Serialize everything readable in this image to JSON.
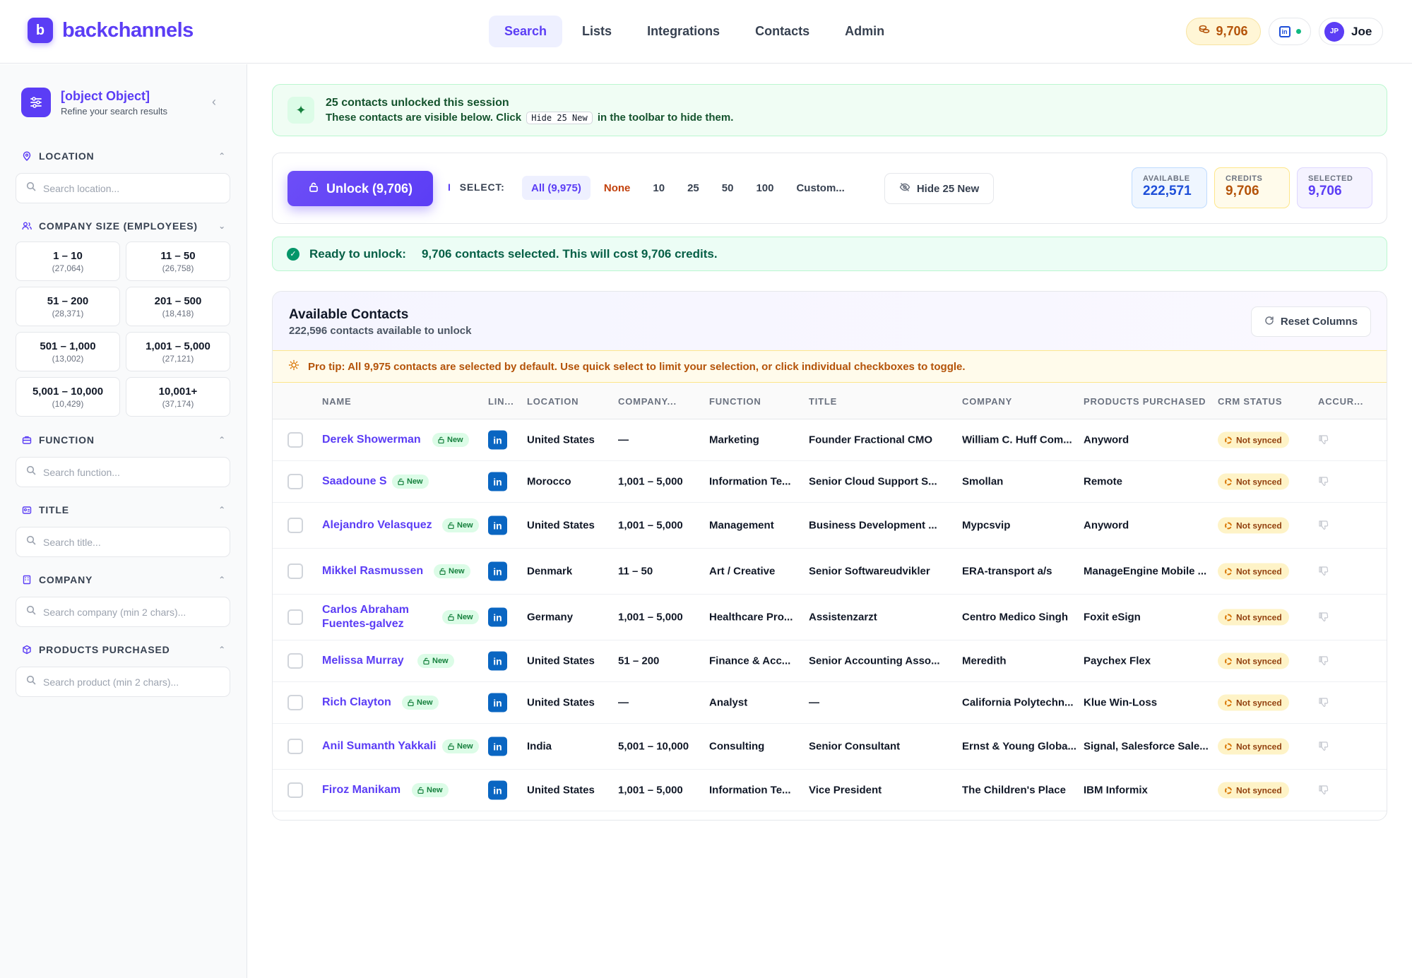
{
  "app": {
    "logo_letter": "b",
    "brand": "backchannels"
  },
  "nav": {
    "items": [
      {
        "label": "Search",
        "active": true
      },
      {
        "label": "Lists",
        "active": false
      },
      {
        "label": "Integrations",
        "active": false
      },
      {
        "label": "Contacts",
        "active": false
      },
      {
        "label": "Admin",
        "active": false
      }
    ]
  },
  "header": {
    "credits": "9,706",
    "user_initials": "JP",
    "user_name": "Joe"
  },
  "sidebar": {
    "title": {
      "heading": "TITLE",
      "placeholder": "Search title..."
    },
    "subtitle": "Refine your search results",
    "location": {
      "heading": "LOCATION",
      "placeholder": "Search location..."
    },
    "company_size": {
      "heading": "COMPANY SIZE (EMPLOYEES)",
      "options": [
        {
          "label": "1 – 10",
          "count": "(27,064)"
        },
        {
          "label": "11 – 50",
          "count": "(26,758)"
        },
        {
          "label": "51 – 200",
          "count": "(28,371)"
        },
        {
          "label": "201 – 500",
          "count": "(18,418)"
        },
        {
          "label": "501 – 1,000",
          "count": "(13,002)"
        },
        {
          "label": "1,001 – 5,000",
          "count": "(27,121)"
        },
        {
          "label": "5,001 – 10,000",
          "count": "(10,429)"
        },
        {
          "label": "10,001+",
          "count": "(37,174)"
        }
      ]
    },
    "function": {
      "heading": "FUNCTION",
      "placeholder": "Search function..."
    },
    "company": {
      "heading": "COMPANY",
      "placeholder": "Search company (min 2 chars)..."
    },
    "products": {
      "heading": "PRODUCTS PURCHASED",
      "placeholder": "Search product (min 2 chars)..."
    }
  },
  "session_banner": {
    "title": "25 contacts unlocked this session",
    "sub_before": "These contacts are visible below. Click",
    "code": "Hide 25 New",
    "sub_after": "in the toolbar to hide them."
  },
  "toolbar": {
    "unlock_label": "Unlock (9,706)",
    "select_label": "SELECT:",
    "select_options": [
      "All (9,975)",
      "None",
      "10",
      "25",
      "50",
      "100",
      "Custom..."
    ],
    "hide_label": "Hide 25 New",
    "stats": {
      "available_label": "AVAILABLE",
      "available_value": "222,571",
      "credits_label": "CREDITS",
      "credits_value": "9,706",
      "selected_label": "SELECTED",
      "selected_value": "9,706"
    }
  },
  "ready": {
    "label": "Ready to unlock:",
    "message": "9,706 contacts selected. This will cost 9,706 credits."
  },
  "table": {
    "title": "Available Contacts",
    "subtitle": "222,596 contacts available to unlock",
    "reset_label": "Reset Columns",
    "tip": "Pro tip: All 9,975 contacts are selected by default. Use quick select to limit your selection, or click individual checkboxes to toggle.",
    "columns": [
      "NAME",
      "LIN...",
      "LOCATION",
      "COMPANY...",
      "FUNCTION",
      "TITLE",
      "COMPANY",
      "PRODUCTS PURCHASED",
      "CRM STATUS",
      "ACCUR..."
    ],
    "new_label": "New",
    "linkedin_label": "in",
    "crm_label": "Not synced",
    "rows": [
      {
        "name": "Derek Showerman",
        "location": "United States",
        "size": "—",
        "function": "Marketing",
        "title": "Founder Fractional CMO",
        "company": "William C. Huff Com...",
        "products": "Anyword"
      },
      {
        "name": "Saadoune S",
        "location": "Morocco",
        "size": "1,001 – 5,000",
        "function": "Information Te...",
        "title": "Senior Cloud Support S...",
        "company": "Smollan",
        "products": "Remote"
      },
      {
        "name": "Alejandro Velasquez",
        "location": "United States",
        "size": "1,001 – 5,000",
        "function": "Management",
        "title": "Business Development ...",
        "company": "Mypcsvip",
        "products": "Anyword"
      },
      {
        "name": "Mikkel Rasmussen",
        "location": "Denmark",
        "size": "11 – 50",
        "function": "Art / Creative",
        "title": "Senior Softwareudvikler",
        "company": "ERA-transport a/s",
        "products": "ManageEngine Mobile ..."
      },
      {
        "name": "Carlos Abraham Fuentes-galvez",
        "location": "Germany",
        "size": "1,001 – 5,000",
        "function": "Healthcare Pro...",
        "title": "Assistenzarzt",
        "company": "Centro Medico Singh",
        "products": "Foxit eSign"
      },
      {
        "name": "Melissa Murray",
        "location": "United States",
        "size": "51 – 200",
        "function": "Finance & Acc...",
        "title": "Senior Accounting Asso...",
        "company": "Meredith",
        "products": "Paychex Flex"
      },
      {
        "name": "Rich Clayton",
        "location": "United States",
        "size": "—",
        "function": "Analyst",
        "title": "—",
        "company": "California Polytechn...",
        "products": "Klue Win-Loss"
      },
      {
        "name": "Anil Sumanth Yakkali",
        "location": "India",
        "size": "5,001 – 10,000",
        "function": "Consulting",
        "title": "Senior Consultant",
        "company": "Ernst & Young Globa...",
        "products": "Signal, Salesforce Sale..."
      },
      {
        "name": "Firoz Manikam",
        "location": "United States",
        "size": "1,001 – 5,000",
        "function": "Information Te...",
        "title": "Vice President",
        "company": "The Children's Place",
        "products": "IBM Informix"
      }
    ]
  }
}
